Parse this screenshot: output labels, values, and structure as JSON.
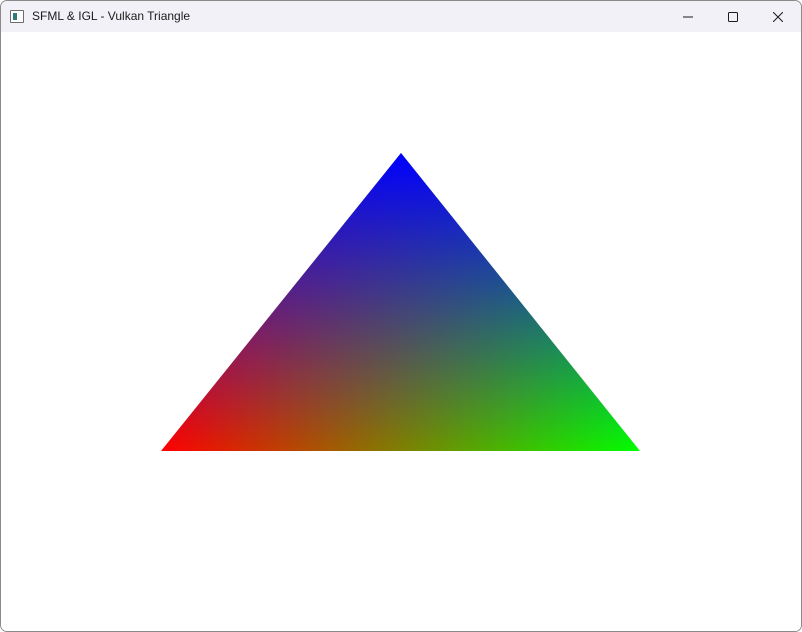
{
  "window": {
    "title": "SFML & IGL - Vulkan Triangle",
    "controls": {
      "minimize_icon": "minimize-icon",
      "maximize_icon": "maximize-icon",
      "close_icon": "close-icon"
    }
  },
  "scene": {
    "background": "#ffffff",
    "triangle": {
      "vertex_colors": {
        "top": "#0000ff",
        "bottom_left": "#ff0000",
        "bottom_right": "#00ff00"
      }
    }
  }
}
